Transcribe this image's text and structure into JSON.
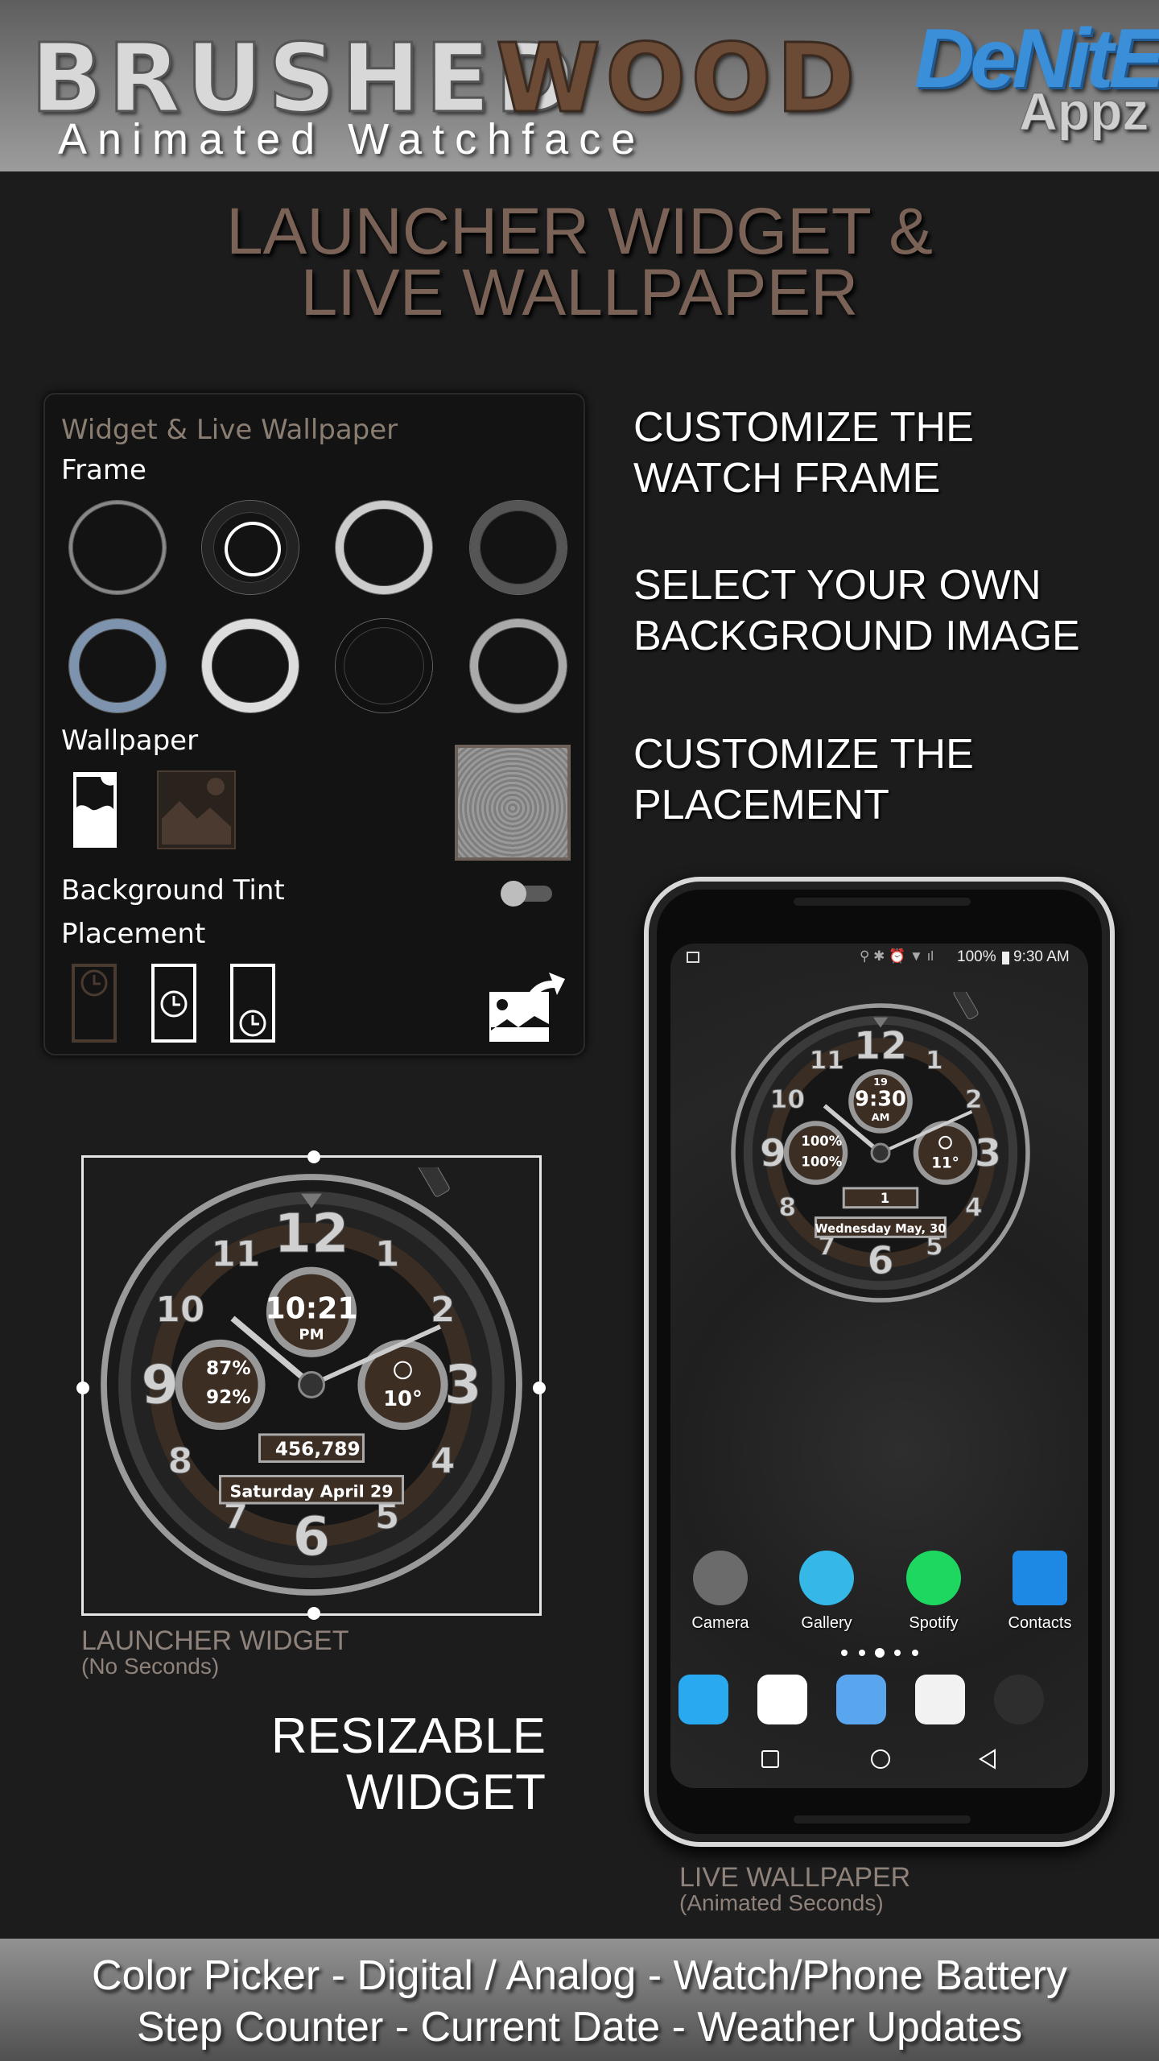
{
  "header": {
    "title_brushed": "BRUSHED",
    "title_wood": "WOOD",
    "subtitle": "Animated Watchface",
    "logo_line1": "DeNitE!",
    "logo_line2": "Appz"
  },
  "headline": {
    "line1": "LAUNCHER WIDGET &",
    "line2": "LIVE WALLPAPER"
  },
  "settings_panel": {
    "title": "Widget & Live Wallpaper",
    "frame_label": "Frame",
    "frame_options": 8,
    "wallpaper_label": "Wallpaper",
    "background_tint_label": "Background Tint",
    "background_tint_on": false,
    "placement_label": "Placement",
    "placement_options": [
      "top",
      "middle",
      "bottom"
    ]
  },
  "features": [
    "CUSTOMIZE THE",
    "WATCH FRAME",
    "SELECT YOUR OWN",
    "BACKGROUND IMAGE",
    "CUSTOMIZE THE",
    "PLACEMENT"
  ],
  "widget_watch": {
    "numerals": [
      "12",
      "1",
      "2",
      "3",
      "4",
      "5",
      "6",
      "7",
      "8",
      "9",
      "10",
      "11"
    ],
    "time": "10:21",
    "ampm": "PM",
    "watch_battery": "87%",
    "phone_battery": "92%",
    "temperature": "10°",
    "steps": "456,789",
    "date": "Saturday April 29",
    "weather_icon": "rain-cloud-icon"
  },
  "widget_caption": {
    "title": "LAUNCHER WIDGET",
    "subtitle": "(No Seconds)"
  },
  "resizable": {
    "line1": "RESIZABLE",
    "line2": "WIDGET"
  },
  "phone": {
    "status": {
      "battery": "100%",
      "time": "9:30 AM"
    },
    "watch": {
      "numerals": [
        "12",
        "1",
        "2",
        "3",
        "4",
        "5",
        "6",
        "7",
        "8",
        "9",
        "10",
        "11"
      ],
      "day": "19",
      "time": "9:30",
      "ampm": "AM",
      "watch_battery": "100%",
      "phone_battery": "100%",
      "temperature": "11°",
      "steps": "1",
      "date": "Wednesday May, 30",
      "weather_icon": "partly-cloudy-icon"
    },
    "apps": [
      {
        "label": "Camera",
        "color": "#6b6b6b"
      },
      {
        "label": "Gallery",
        "color": "#35b7e8"
      },
      {
        "label": "Spotify",
        "color": "#1ed760"
      },
      {
        "label": "Contacts",
        "color": "#1e88e5"
      }
    ],
    "page_dots": 5,
    "active_dot": 3,
    "dock": [
      "phone-icon",
      "chrome-icon",
      "messages-icon",
      "email-icon",
      "app-drawer-icon"
    ]
  },
  "wallpaper_caption": {
    "title": "LIVE WALLPAPER",
    "subtitle": "(Animated Seconds)"
  },
  "bottom_band": {
    "line1": "Color Picker - Digital / Analog - Watch/Phone Battery",
    "line2": "Step Counter - Current Date - Weather Updates"
  },
  "colors": {
    "accent_brown": "#7a6356",
    "panel_bg": "#131313",
    "logo_blue": "#3a8fd8"
  }
}
